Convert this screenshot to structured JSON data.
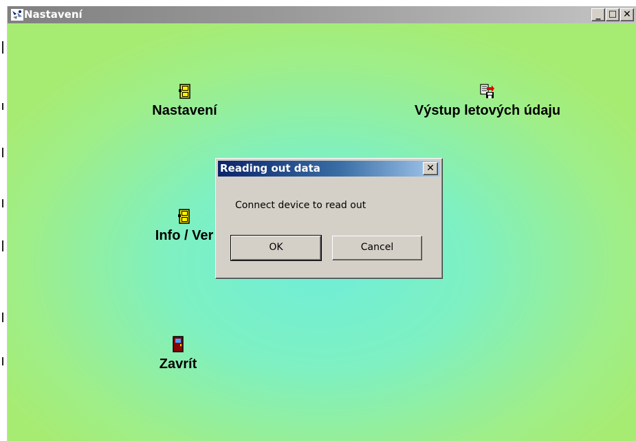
{
  "window": {
    "title": "Nastavení",
    "caption_buttons": {
      "minimize": "_",
      "maximize": "□",
      "close": "✕"
    }
  },
  "menu": [
    {
      "label": "Nastavení",
      "icon": "cabinet-icon"
    },
    {
      "label": "Výstup letových údaju",
      "icon": "export-document-icon"
    },
    {
      "label": "Info / Ver",
      "icon": "cabinet-icon"
    },
    {
      "label": "Zavrít",
      "icon": "exit-door-icon"
    }
  ],
  "dialog": {
    "title": "Reading out data",
    "close": "✕",
    "message": "Connect device to read out",
    "ok_label": "OK",
    "cancel_label": "Cancel"
  },
  "colors": {
    "background_center": "#70eed8",
    "background_edge": "#a7ec72",
    "dialog_title_start": "#0a246a",
    "dialog_title_end": "#a6caf0"
  }
}
